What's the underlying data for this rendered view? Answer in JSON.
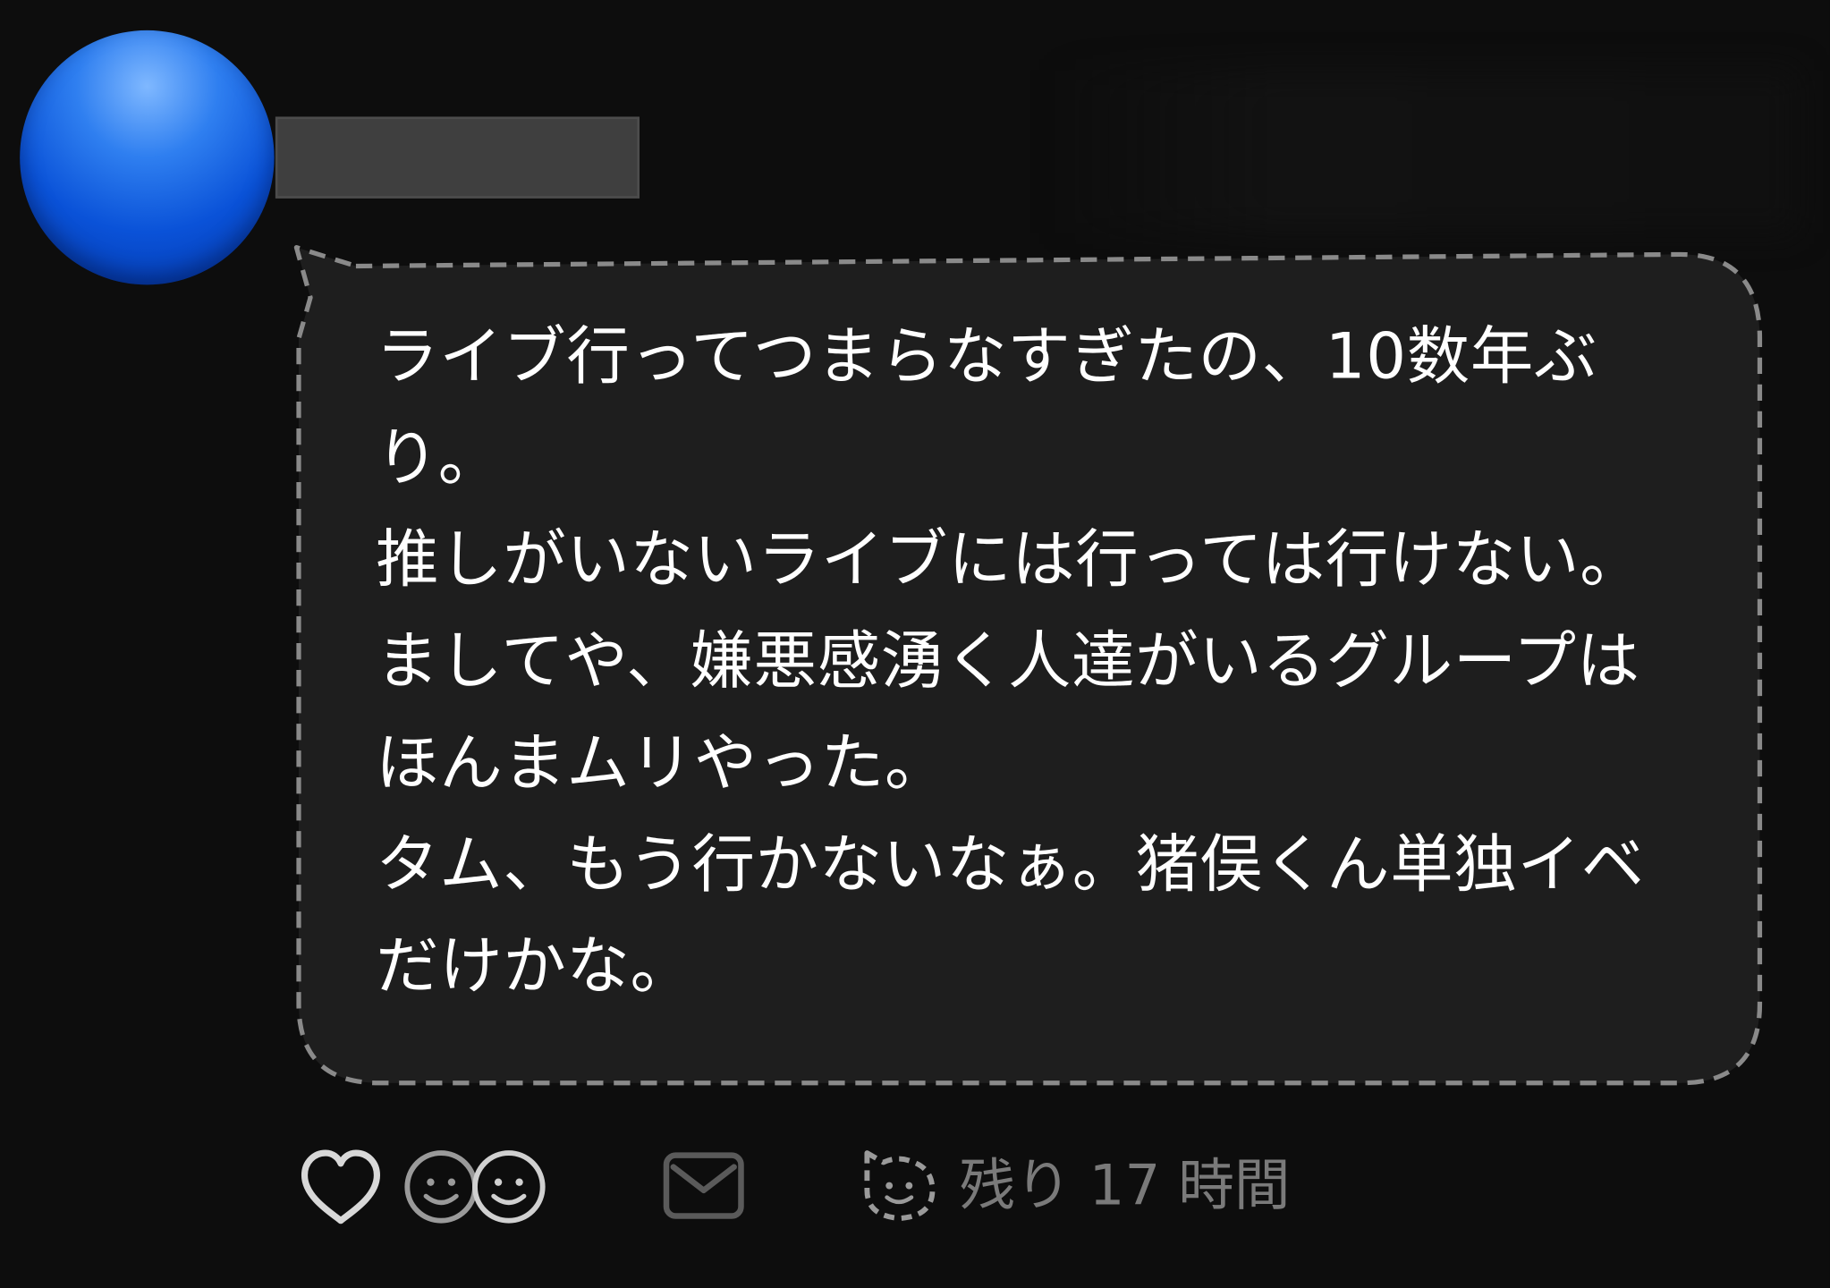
{
  "post": {
    "message_lines": [
      "ライブ行ってつまらなすぎたの、10数年ぶ",
      "り。",
      "推しがいないライブには行っては行けない。",
      "ましてや、嫌悪感湧く人達がいるグループは",
      "ほんまムリやった。",
      "タム、もう行かないなぁ。猪俣くん単独イベ",
      "だけかな。"
    ],
    "remaining_time": "残り 17 時間"
  },
  "icons": {
    "avatar": "avatar-circle",
    "like": "heart-icon",
    "reaction": "smiley-faces-icon",
    "message": "envelope-icon",
    "timer": "cat-face-timer-icon"
  },
  "colors": {
    "background": "#0d0d0d",
    "bubble_fill": "#1e1e1e",
    "bubble_border": "#8a8a8a",
    "text": "#ffffff",
    "muted": "#7a7a7a",
    "avatar": "#0a52d8"
  }
}
